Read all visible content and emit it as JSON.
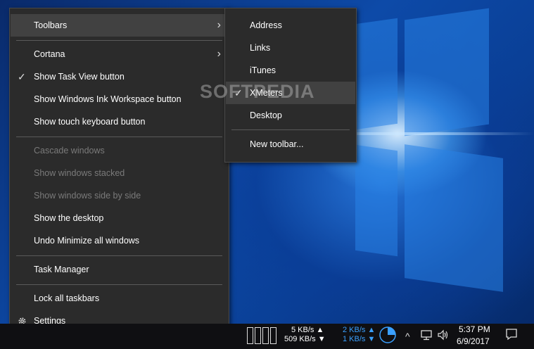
{
  "context_menu": {
    "items": [
      {
        "label": "Toolbars",
        "submenu": true
      },
      {
        "label": "Cortana",
        "submenu": true
      },
      {
        "label": "Show Task View button",
        "checked": true
      },
      {
        "label": "Show Windows Ink Workspace button"
      },
      {
        "label": "Show touch keyboard button"
      },
      {
        "label": "Cascade windows",
        "disabled": true
      },
      {
        "label": "Show windows stacked",
        "disabled": true
      },
      {
        "label": "Show windows side by side",
        "disabled": true
      },
      {
        "label": "Show the desktop"
      },
      {
        "label": "Undo Minimize all windows"
      },
      {
        "label": "Task Manager"
      },
      {
        "label": "Lock all taskbars"
      },
      {
        "label": "Settings",
        "icon": "gear-icon"
      }
    ]
  },
  "toolbars_submenu": {
    "items": [
      {
        "label": "Address"
      },
      {
        "label": "Links"
      },
      {
        "label": "iTunes"
      },
      {
        "label": "XMeters",
        "checked": true
      },
      {
        "label": "Desktop"
      },
      {
        "label": "New toolbar..."
      }
    ]
  },
  "watermark": "SOFTPEDIA",
  "taskbar": {
    "network_up": "5 KB/s",
    "network_down": "509 KB/s",
    "disk_up": "2 KB/s",
    "disk_down": "1 KB/s",
    "time": "5:37 PM",
    "date": "6/9/2017",
    "colors": {
      "disk": "#3aa0ff",
      "taskbar_bg": "#0f0f12"
    }
  }
}
